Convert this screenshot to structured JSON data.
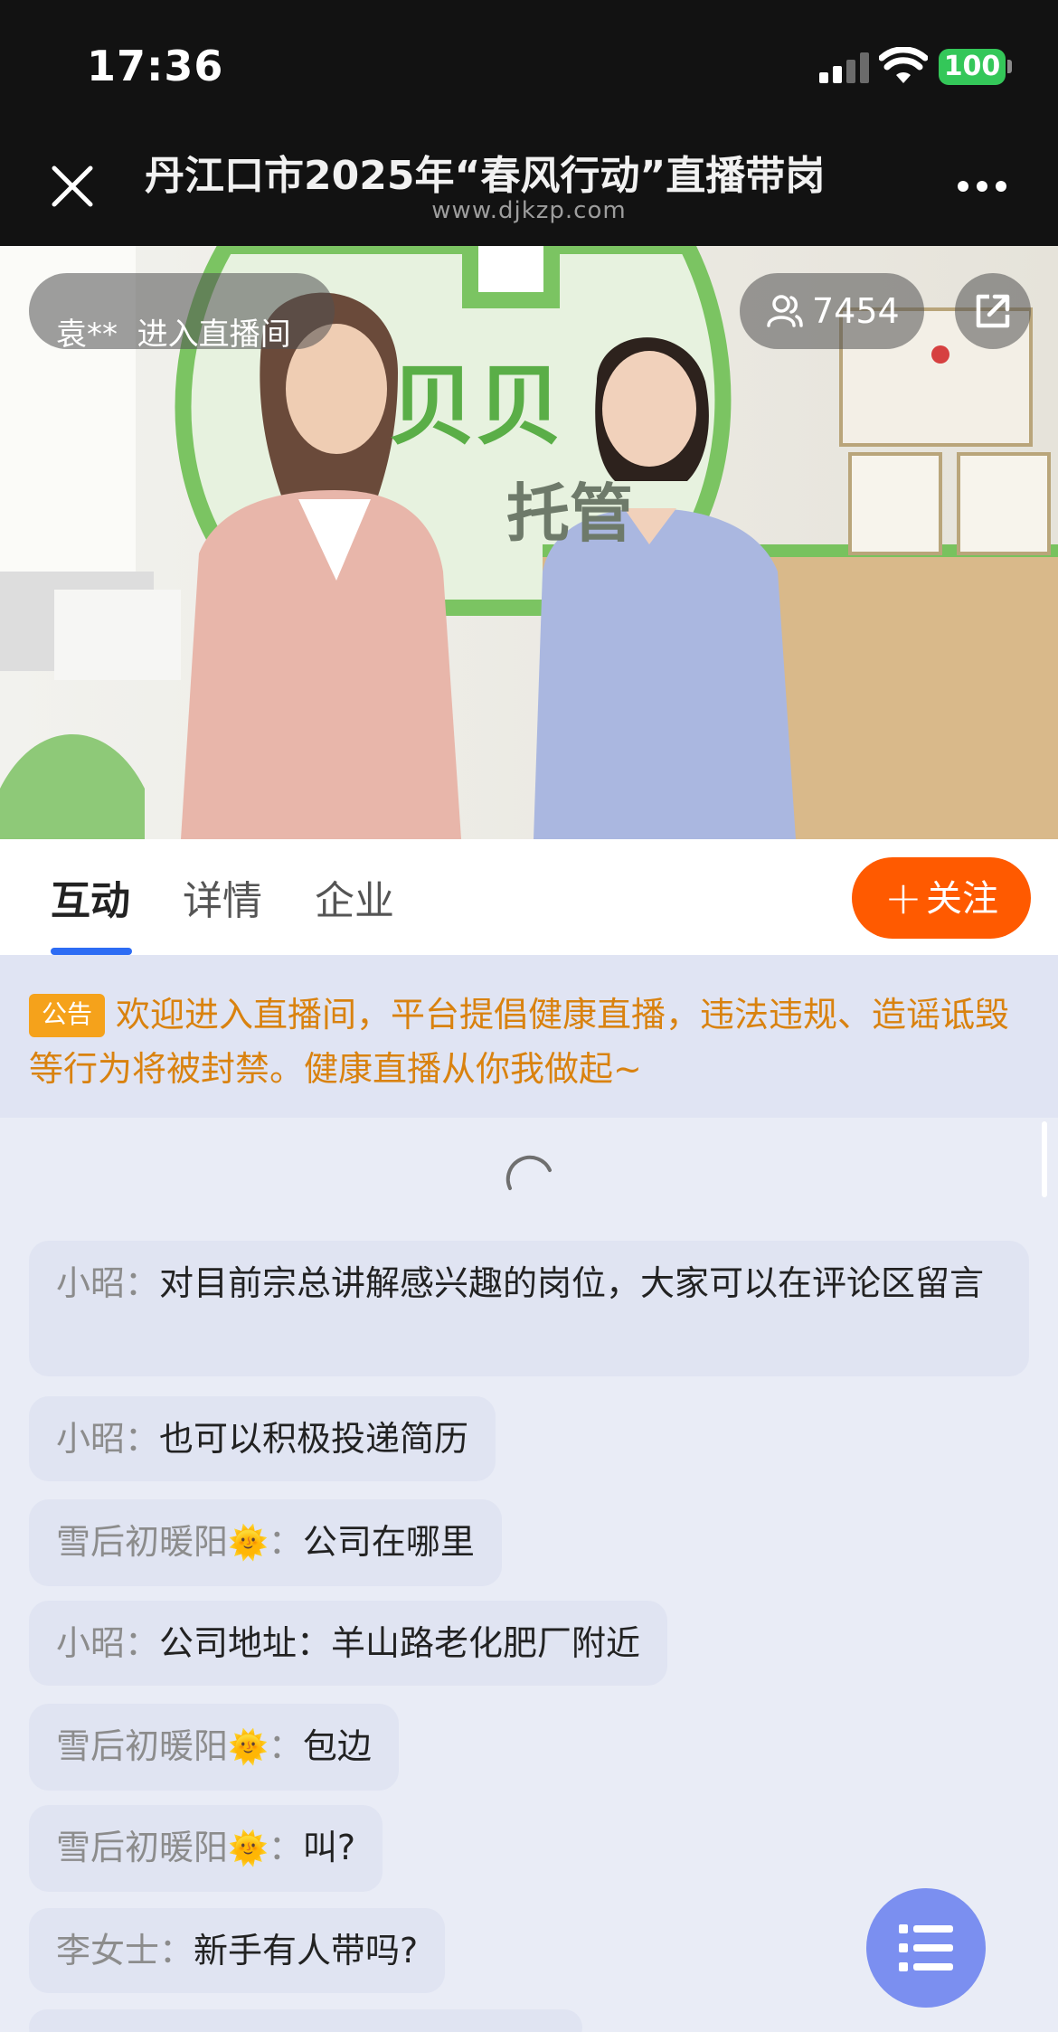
{
  "status_bar": {
    "time": "17:36",
    "battery": "100"
  },
  "nav": {
    "title": "丹江口市2025年“春风行动”直播带岗",
    "url": "www.djkzp.com",
    "icons": {
      "close": "close-icon",
      "more": "more-icon"
    }
  },
  "video": {
    "enter_notice": "袁**  进入直播间",
    "viewer_count": "7454",
    "icons": {
      "viewers": "people-icon",
      "share": "share-icon"
    }
  },
  "tabs": [
    {
      "label": "互动",
      "active": true
    },
    {
      "label": "详情",
      "active": false
    },
    {
      "label": "企业",
      "active": false
    }
  ],
  "follow_button": {
    "plus": "+",
    "label": "关注"
  },
  "notice": {
    "badge": "公告",
    "text": "欢迎进入直播间，平台提倡健康直播，违法违规、造谣诋毁等行为将被封禁。健康直播从你我做起~"
  },
  "messages": [
    {
      "name": "小昭：",
      "text": "对目前宗总讲解感兴趣的岗位，大家可以在评论区留言"
    },
    {
      "name": "小昭：",
      "text": "也可以积极投递简历"
    },
    {
      "name": "雪后初暖阳",
      "emoji": "🌞",
      "sep": "：",
      "text": "公司在哪里"
    },
    {
      "name": "小昭：",
      "text": "公司地址：羊山路老化肥厂附近"
    },
    {
      "name": "雪后初暖阳",
      "emoji": "🌞",
      "sep": "：",
      "text": "包边"
    },
    {
      "name": "雪后初暖阳",
      "emoji": "🌞",
      "sep": "：",
      "text": "叫?"
    },
    {
      "name": "李女士：",
      "text": "新手有人带吗?"
    }
  ],
  "colors": {
    "accent_blue": "#2d6cf4",
    "follow_orange": "#ff5a00",
    "notice_orange": "#d9820f",
    "fab_blue": "#7b8ff0"
  }
}
